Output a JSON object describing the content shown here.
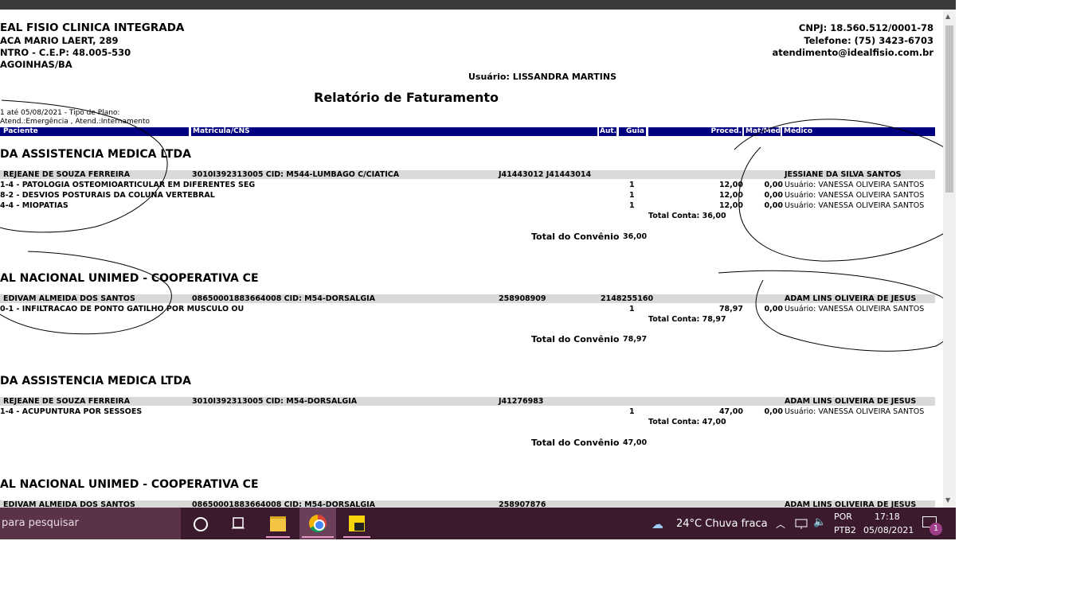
{
  "clinic": {
    "name": "EAL FISIO CLINICA INTEGRADA",
    "address": "ACA MARIO LAERT, 289",
    "district": "NTRO - C.E.P: 48.005-530",
    "city": "AGOINHAS/BA",
    "cnpj": "CNPJ: 18.560.512/0001-78",
    "phone": "Telefone: (75) 3423-6703",
    "email": "atendimento@idealfisio.com.br"
  },
  "report": {
    "user": "Usuário: LISSANDRA MARTINS",
    "title": "Relatório de Faturamento",
    "filter_line1": "1 até 05/08/2021 - Tipo de Plano:",
    "filter_line2": "Atend.:Emergência , Atend.:Internamento"
  },
  "columns": {
    "paciente": "Paciente",
    "matricula": "Matricula/CNS",
    "aut": "Aut.",
    "guia": "Guia",
    "proced": "Proced.",
    "matmed": "Mat/Med",
    "medico": "Médico"
  },
  "sections": [
    {
      "convenio": "DA ASSISTENCIA MEDICA LTDA",
      "patient": "REJEANE DE SOUZA FERREIRA",
      "matricula": "3010I392313005 CID: M544-LUMBAGO C/CIATICA",
      "aut": "J41443012 J41443014",
      "guia": "",
      "medico": "JESSIANE DA SILVA SANTOS",
      "items": [
        {
          "desc": "1-4 - PATOLOGIA OSTEOMIOARTICULAR EM DIFERENTES SEG",
          "qty": "1",
          "proced": "12,00",
          "matmed": "0,00",
          "user": "Usuário: VANESSA OLIVEIRA SANTOS"
        },
        {
          "desc": "8-2 - DESVIOS POSTURAIS DA COLUNA VERTEBRAL",
          "qty": "1",
          "proced": "12,00",
          "matmed": "0,00",
          "user": "Usuário: VANESSA OLIVEIRA SANTOS"
        },
        {
          "desc": "4-4 - MIOPATIAS",
          "qty": "1",
          "proced": "12,00",
          "matmed": "0,00",
          "user": "Usuário: VANESSA OLIVEIRA SANTOS"
        }
      ],
      "total_conta": "Total Conta: 36,00",
      "total_convenio_label": "Total do Convênio",
      "total_convenio": "36,00"
    },
    {
      "convenio": "AL NACIONAL UNIMED - COOPERATIVA CE",
      "patient": "EDIVAM ALMEIDA DOS SANTOS",
      "matricula": "08650001883664008 CID: M54-DORSALGIA",
      "aut": "258908909",
      "guia": "2148255160",
      "medico": "ADAM LINS OLIVEIRA DE JESUS",
      "items": [
        {
          "desc": "0-1 - INFILTRACAO DE PONTO GATILHO POR MUSCULO OU",
          "qty": "1",
          "proced": "78,97",
          "matmed": "0,00",
          "user": "Usuário: VANESSA OLIVEIRA SANTOS"
        }
      ],
      "total_conta": "Total Conta: 78,97",
      "total_convenio_label": "Total do Convênio",
      "total_convenio": "78,97"
    },
    {
      "convenio": "DA ASSISTENCIA MEDICA LTDA",
      "patient": "REJEANE DE SOUZA FERREIRA",
      "matricula": "3010I392313005 CID: M54-DORSALGIA",
      "aut": "J41276983",
      "guia": "",
      "medico": "ADAM LINS OLIVEIRA DE JESUS",
      "items": [
        {
          "desc": "1-4 - ACUPUNTURA POR SESSOES",
          "qty": "1",
          "proced": "47,00",
          "matmed": "0,00",
          "user": "Usuário: VANESSA OLIVEIRA SANTOS"
        }
      ],
      "total_conta": "Total Conta: 47,00",
      "total_convenio_label": "Total do Convênio",
      "total_convenio": "47,00"
    },
    {
      "convenio": "AL NACIONAL UNIMED - COOPERATIVA CE",
      "patient": "EDIVAM ALMEIDA DOS SANTOS",
      "matricula": "08650001883664008 CID: M54-DORSALGIA",
      "aut": "258907876",
      "guia": "",
      "medico": "ADAM LINS OLIVEIRA DE JESUS"
    }
  ],
  "taskbar": {
    "search_placeholder": "para pesquisar",
    "weather": "24°C  Chuva fraca",
    "lang1": "POR",
    "lang2": "PTB2",
    "time": "17:18",
    "date": "05/08/2021",
    "notifications": "1"
  },
  "colors": {
    "header_bar": "#000080",
    "row_grey": "#d9d9d9",
    "taskbar": "#3b1a2e"
  }
}
